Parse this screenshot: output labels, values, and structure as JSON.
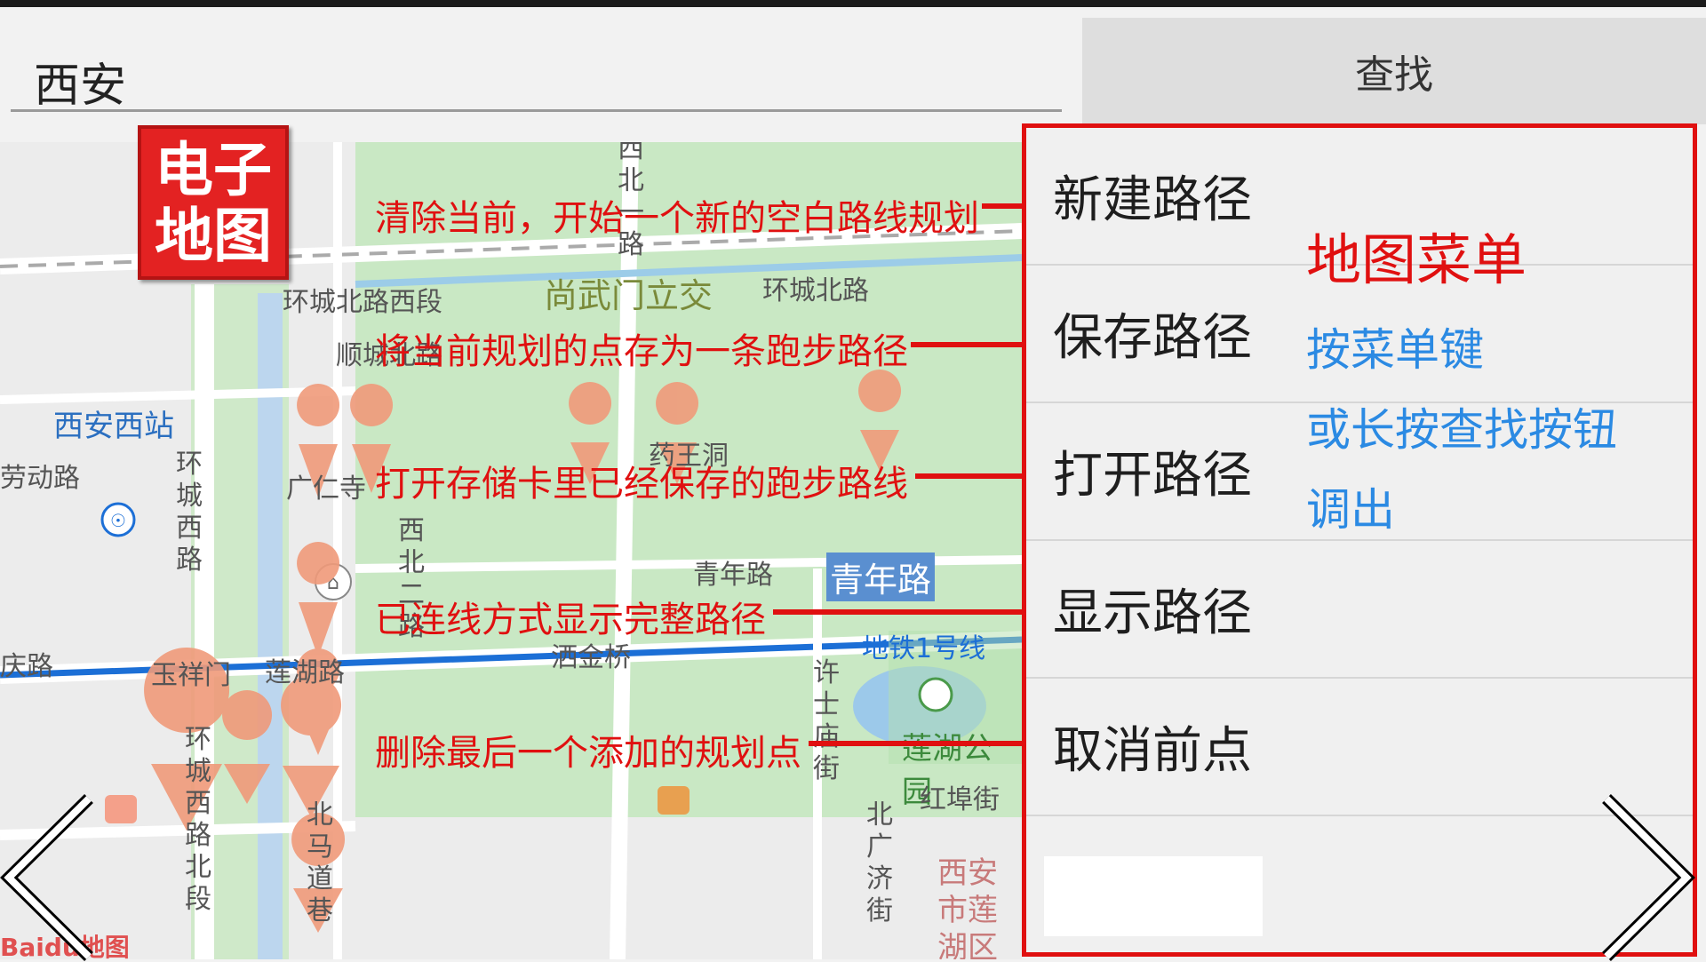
{
  "search": {
    "value": "西安",
    "button_label": "查找"
  },
  "logo": {
    "line1": "电子",
    "line2": "地图"
  },
  "menu": {
    "title": "地图菜单",
    "items": [
      "新建路径",
      "保存路径",
      "打开路径",
      "显示路径",
      "取消前点"
    ],
    "hints": [
      "按菜单键",
      "或长按查找按钮",
      "调出"
    ]
  },
  "annotations": [
    "清除当前，开始一个新的空白路线规划",
    "将当前规划的点存为一条跑步路径",
    "打开存储卡里已经保存的跑步路线",
    "已连线方式显示完整路径",
    "删除最后一个添加的规划点"
  ],
  "map_labels": {
    "station": "西安西站",
    "subway": "地铁1号线",
    "park": "莲湖公园",
    "road1": "环城北路西段",
    "road2": "青年路",
    "road3": "洒金桥",
    "road4": "红埠街",
    "road5": "环城北路",
    "road6": "尚武门立交",
    "road7": "北马道巷",
    "road8": "西安市莲湖区",
    "road9": "药王洞",
    "road10": "庆路",
    "road11": "广仁寺",
    "road12": "莲湖路",
    "road13": "玉祥门",
    "road14": "顺城北路",
    "road15": "许士庙街",
    "road16": "北广济街",
    "road17": "西北一路",
    "road18": "西北二路",
    "road19": "环城西路",
    "road20": "环城西路北段",
    "road21": "劳动路"
  },
  "brand": "Baidu地图",
  "colors": {
    "accent": "#e01010",
    "hint": "#2b8ae3",
    "park": "#c9e8c4",
    "subway": "#1c6fd6",
    "pin": "#f09a7a"
  }
}
